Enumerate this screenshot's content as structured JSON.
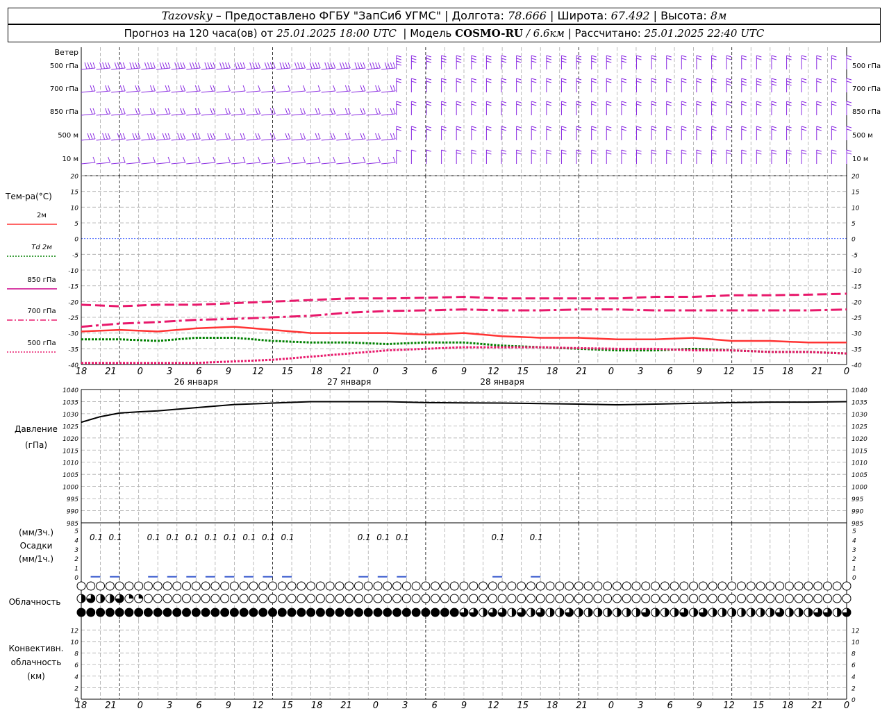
{
  "header": {
    "station": "Tazovsky",
    "provider": "– Предоставлено ФГБУ \"ЗапСиб УГМС\"",
    "lon_label": "Долгота:",
    "lon": "78.666",
    "lat_label": "Широта:",
    "lat": "67.492",
    "alt_label": "Высота:",
    "alt": "8м",
    "forecast_label": "Прогноз на 120 часа(ов) от",
    "run": "25.01.2025 18:00 UTC",
    "model_label": "Модель",
    "model": "COSMO-RU",
    "resolution": "/ 6.6км",
    "computed_label": "Рассчитано:",
    "computed": "25.01.2025 22:40 UTC"
  },
  "panels": {
    "wind": {
      "title": "Ветер",
      "levels": [
        "500 гПа",
        "700 гПа",
        "850 гПа",
        "500 м",
        "10 м"
      ]
    },
    "temperature": {
      "title": "Тем-ра(°C)",
      "legend": [
        {
          "label": "2м",
          "color": "#ff3333",
          "style": "solid"
        },
        {
          "label": "Td 2м",
          "color": "#008000",
          "style": "dotted"
        },
        {
          "label": "850 гПа",
          "color": "#cc0088",
          "style": "solid"
        },
        {
          "label": "700 гПа",
          "color": "#e8186b",
          "style": "dashdot"
        },
        {
          "label": "500 гПа",
          "color": "#e8186b",
          "style": "dotted"
        }
      ]
    },
    "pressure": {
      "title1": "Давление",
      "title2": "(гПа)"
    },
    "precip": {
      "title1": "(мм/3ч.)",
      "title2": "Осадки",
      "title3": "(мм/1ч.)"
    },
    "cloud": {
      "title": "Облачность"
    },
    "convective": {
      "title1": "Конвективн.",
      "title2": "облачность",
      "title3": "(км)"
    }
  },
  "time_axis": {
    "ticks": [
      "18",
      "21",
      "0",
      "3",
      "6",
      "9",
      "12",
      "15",
      "18",
      "21",
      "0",
      "3",
      "6",
      "9",
      "12",
      "15",
      "18",
      "21",
      "0",
      "3",
      "6",
      "9",
      "12",
      "15",
      "18",
      "21",
      "0"
    ],
    "days": [
      "26 января",
      "27 января",
      "28 января"
    ]
  },
  "chart_data": [
    {
      "type": "line",
      "title": "Тем-ра(°C)",
      "x_hours": [
        0,
        6,
        12,
        18,
        24,
        30,
        36,
        42,
        48,
        54,
        60,
        66,
        72,
        78,
        84,
        90,
        96,
        102,
        108,
        114,
        120
      ],
      "ylim": [
        -40,
        20
      ],
      "yticks": [
        -40,
        -35,
        -30,
        -25,
        -20,
        -15,
        -10,
        -5,
        0,
        5,
        10,
        15,
        20
      ],
      "series": [
        {
          "name": "2м",
          "color": "#ff3333",
          "values": [
            -29.5,
            -29,
            -29.5,
            -28.5,
            -28,
            -29,
            -30,
            -30,
            -30,
            -30.5,
            -30,
            -31,
            -31.5,
            -31.5,
            -32,
            -32,
            -31.5,
            -32.5,
            -32.5,
            -33,
            -33
          ]
        },
        {
          "name": "Td 2м",
          "color": "#008000",
          "values": [
            -32,
            -32,
            -32.5,
            -31.5,
            -31.5,
            -32.5,
            -33,
            -33,
            -33.5,
            -33,
            -33,
            -34,
            -34.5,
            -35,
            -35.5,
            -35.5,
            -35,
            -35.5,
            -36,
            -36,
            -36.5
          ]
        },
        {
          "name": "850 гПа",
          "color": "#e8186b",
          "values": [
            -21,
            -21.5,
            -21,
            -21,
            -20.5,
            -20,
            -19.5,
            -19,
            -19,
            -18.8,
            -18.5,
            -19,
            -19,
            -19,
            -19,
            -18.5,
            -18.5,
            -18,
            -18,
            -17.8,
            -17.5
          ]
        },
        {
          "name": "700 гПа",
          "color": "#e8186b",
          "values": [
            -28,
            -27,
            -26.5,
            -25.8,
            -25.5,
            -25,
            -24.5,
            -23.5,
            -23,
            -22.8,
            -22.5,
            -22.8,
            -22.8,
            -22.5,
            -22.5,
            -22.8,
            -22.8,
            -22.8,
            -22.8,
            -22.8,
            -22.5
          ]
        },
        {
          "name": "500 гПа",
          "color": "#e8186b",
          "values": [
            -39.5,
            -39.5,
            -39.5,
            -39.5,
            -39,
            -38.5,
            -37.5,
            -36.5,
            -35.5,
            -35,
            -34.5,
            -34.5,
            -34.5,
            -34.8,
            -35,
            -35,
            -35.5,
            -35.5,
            -36,
            -36,
            -36.5
          ]
        }
      ]
    },
    {
      "type": "line",
      "title": "Давление",
      "ylabel": "(гПа)",
      "x_hours": [
        0,
        3,
        6,
        9,
        12,
        18,
        24,
        30,
        36,
        42,
        48,
        54,
        60,
        66,
        72,
        78,
        84,
        90,
        96,
        102,
        108,
        114,
        120
      ],
      "ylim": [
        985,
        1040
      ],
      "yticks": [
        985,
        990,
        995,
        1000,
        1005,
        1010,
        1015,
        1020,
        1025,
        1030,
        1035,
        1040
      ],
      "series": [
        {
          "name": "",
          "color": "#000000",
          "values": [
            1026.5,
            1028.8,
            1030.3,
            1030.8,
            1031.2,
            1032.5,
            1033.8,
            1034.4,
            1035.0,
            1035.0,
            1035.0,
            1034.6,
            1034.5,
            1034.4,
            1034.2,
            1034.0,
            1033.7,
            1034.0,
            1034.3,
            1034.6,
            1034.8,
            1034.8,
            1035.0
          ]
        }
      ]
    },
    {
      "type": "bar",
      "title": "Осадки",
      "ylabel": "(мм/3ч.) (мм/1ч.)",
      "ylim": [
        0,
        5
      ],
      "x_hours": [
        3,
        6,
        12,
        15,
        18,
        21,
        24,
        27,
        30,
        33,
        45,
        48,
        51,
        66,
        72
      ],
      "labels": [
        "0.1",
        "0.1",
        "0.1",
        "0.1",
        "0.1",
        "0.1",
        "0.1",
        "0.1",
        "0.1",
        "0.1",
        "0.1",
        "0.1",
        "0.1",
        "0.1",
        "0.1"
      ],
      "values": [
        0.1,
        0.1,
        0.1,
        0.1,
        0.1,
        0.1,
        0.1,
        0.1,
        0.1,
        0.1,
        0.1,
        0.1,
        0.1,
        0.1,
        0.1
      ]
    },
    {
      "type": "scatter",
      "title": "Облачность",
      "rows": [
        {
          "name": "upper",
          "cover": [
            0,
            0,
            0,
            0,
            0,
            0,
            0,
            0,
            0,
            0,
            0,
            0,
            0,
            0,
            0,
            0,
            0,
            0,
            0,
            0,
            0,
            0,
            0,
            0,
            0,
            0,
            0,
            0,
            0,
            0,
            0,
            0,
            0,
            0,
            0,
            0,
            0,
            0,
            0,
            0,
            0,
            0,
            0,
            0,
            0,
            0,
            0,
            0,
            0,
            0,
            0,
            0,
            0,
            0,
            0,
            0,
            0,
            0,
            0,
            0,
            0,
            0,
            0,
            0,
            0,
            0,
            0,
            0,
            0,
            0,
            0,
            0,
            0,
            0,
            0,
            0,
            0,
            0,
            0,
            0,
            0
          ]
        },
        {
          "name": "middle",
          "cover": [
            0.5,
            0.75,
            0.5,
            0.5,
            0.75,
            0.25,
            0.25,
            0,
            0,
            0,
            0,
            0,
            0,
            0,
            0,
            0,
            0,
            0,
            0,
            0,
            0,
            0,
            0,
            0,
            0,
            0,
            0,
            0,
            0,
            0,
            0,
            0,
            0,
            0,
            0,
            0,
            0,
            0,
            0,
            0,
            0,
            0,
            0,
            0,
            0,
            0,
            0,
            0,
            0,
            0,
            0,
            0,
            0,
            0,
            0,
            0,
            0,
            0,
            0,
            0,
            0,
            0,
            0,
            0,
            0,
            0,
            0,
            0,
            0,
            0,
            0,
            0,
            0,
            0,
            0,
            0,
            0,
            0,
            0,
            0,
            0
          ]
        },
        {
          "name": "lower",
          "cover": [
            1,
            1,
            1,
            1,
            1,
            1,
            1,
            1,
            1,
            1,
            1,
            1,
            1,
            1,
            1,
            1,
            1,
            1,
            1,
            1,
            1,
            1,
            1,
            1,
            1,
            1,
            1,
            1,
            1,
            1,
            1,
            1,
            1,
            1,
            1,
            1,
            1,
            1,
            1,
            1,
            0.75,
            0.75,
            0.5,
            0.75,
            0.75,
            0.5,
            0.75,
            0.5,
            0.75,
            0.5,
            0.5,
            0.75,
            0.5,
            0.5,
            0.5,
            0.5,
            0.5,
            0.5,
            0.5,
            0.75,
            0.5,
            0.5,
            0.5,
            0.75,
            0.5,
            0.75,
            0.5,
            0.5,
            0.5,
            0.5,
            0.5,
            0.5,
            0.5,
            0.75,
            0.5,
            0.5,
            0.5,
            0.75,
            0.75,
            0.5,
            0.75
          ]
        }
      ]
    },
    {
      "type": "bar",
      "title": "Конвективн. облачность",
      "ylabel": "(км)",
      "ylim": [
        0,
        13
      ],
      "yticks": [
        0,
        2,
        4,
        6,
        8,
        10,
        12
      ],
      "values": []
    },
    {
      "type": "scatter",
      "title": "Ветер",
      "levels": [
        "500 гПа",
        "700 гПа",
        "850 гПа",
        "500 м",
        "10 м"
      ],
      "speed_ms": [
        [
          20,
          20,
          20,
          20,
          20,
          20,
          18,
          18,
          18,
          17,
          16,
          14,
          14,
          13,
          13,
          12,
          12,
          12,
          12,
          12,
          12
        ],
        [
          12,
          12,
          10,
          8,
          5,
          2,
          6,
          8,
          9,
          10,
          10,
          11,
          12,
          12,
          12,
          12,
          12,
          13,
          13,
          12,
          12
        ],
        [
          10,
          10,
          10,
          10,
          9,
          8,
          8,
          9,
          9,
          10,
          10,
          10,
          10,
          11,
          11,
          11,
          11,
          11,
          11,
          12,
          12
        ],
        [
          13,
          13,
          13,
          13,
          12,
          12,
          12,
          12,
          12,
          12,
          12,
          12,
          12,
          12,
          12,
          12,
          12,
          12,
          12,
          12,
          12
        ],
        [
          5,
          5,
          5,
          5,
          5,
          6,
          6,
          6,
          7,
          7,
          8,
          8,
          8,
          8,
          8,
          8,
          8,
          8,
          8,
          8,
          8
        ]
      ]
    }
  ]
}
